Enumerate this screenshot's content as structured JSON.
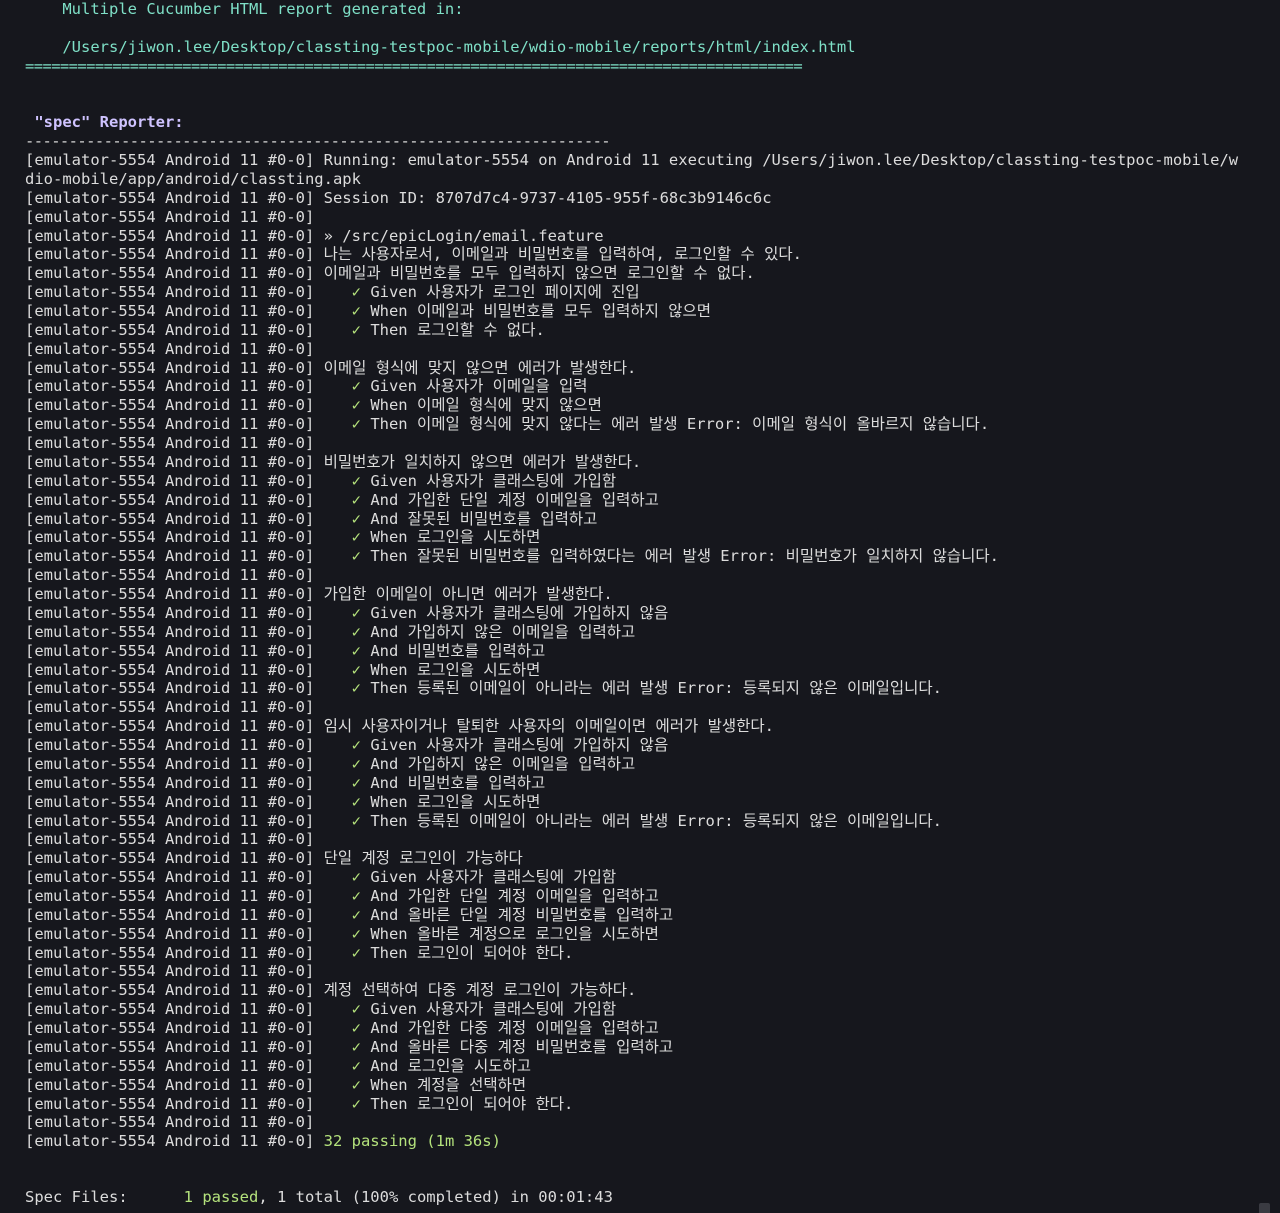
{
  "report": {
    "generated_label": "    Multiple Cucumber HTML report generated in:",
    "path": "    /Users/jiwon.lee/Desktop/classting-testpoc-mobile/wdio-mobile/reports/html/index.html",
    "separator": "========================================================================================="
  },
  "reporter": {
    "title": " \"spec\" Reporter:",
    "rule": "-------------------------------------------------------------------"
  },
  "log_lines": [
    {
      "prefix": "[emulator-5554 Android 11 #0-0] ",
      "text": "Running: emulator-5554 on Android 11 executing /Users/jiwon.lee/Desktop/classting-testpoc-mobile/w"
    },
    {
      "prefix": "",
      "text": "dio-mobile/app/android/classting.apk"
    },
    {
      "prefix": "[emulator-5554 Android 11 #0-0] ",
      "text": "Session ID: 8707d7c4-9737-4105-955f-68c3b9146c6c"
    },
    {
      "prefix": "[emulator-5554 Android 11 #0-0]",
      "text": ""
    },
    {
      "prefix": "[emulator-5554 Android 11 #0-0] ",
      "text": "» /src/epicLogin/email.feature"
    },
    {
      "prefix": "[emulator-5554 Android 11 #0-0] ",
      "text": "나는 사용자로서, 이메일과 비밀번호를 입력하여, 로그인할 수 있다."
    },
    {
      "prefix": "[emulator-5554 Android 11 #0-0] ",
      "text": "이메일과 비밀번호를 모두 입력하지 않으면 로그인할 수 없다."
    },
    {
      "prefix": "[emulator-5554 Android 11 #0-0] ",
      "check": "✓",
      "text": "Given 사용자가 로그인 페이지에 진입"
    },
    {
      "prefix": "[emulator-5554 Android 11 #0-0] ",
      "check": "✓",
      "text": "When 이메일과 비밀번호를 모두 입력하지 않으면"
    },
    {
      "prefix": "[emulator-5554 Android 11 #0-0] ",
      "check": "✓",
      "text": "Then 로그인할 수 없다."
    },
    {
      "prefix": "[emulator-5554 Android 11 #0-0]",
      "text": ""
    },
    {
      "prefix": "[emulator-5554 Android 11 #0-0] ",
      "text": "이메일 형식에 맞지 않으면 에러가 발생한다."
    },
    {
      "prefix": "[emulator-5554 Android 11 #0-0] ",
      "check": "✓",
      "text": "Given 사용자가 이메일을 입력"
    },
    {
      "prefix": "[emulator-5554 Android 11 #0-0] ",
      "check": "✓",
      "text": "When 이메일 형식에 맞지 않으면"
    },
    {
      "prefix": "[emulator-5554 Android 11 #0-0] ",
      "check": "✓",
      "text": "Then 이메일 형식에 맞지 않다는 에러 발생 Error: 이메일 형식이 올바르지 않습니다."
    },
    {
      "prefix": "[emulator-5554 Android 11 #0-0]",
      "text": ""
    },
    {
      "prefix": "[emulator-5554 Android 11 #0-0] ",
      "text": "비밀번호가 일치하지 않으면 에러가 발생한다."
    },
    {
      "prefix": "[emulator-5554 Android 11 #0-0] ",
      "check": "✓",
      "text": "Given 사용자가 클래스팅에 가입함"
    },
    {
      "prefix": "[emulator-5554 Android 11 #0-0] ",
      "check": "✓",
      "text": "And 가입한 단일 계정 이메일을 입력하고"
    },
    {
      "prefix": "[emulator-5554 Android 11 #0-0] ",
      "check": "✓",
      "text": "And 잘못된 비밀번호를 입력하고"
    },
    {
      "prefix": "[emulator-5554 Android 11 #0-0] ",
      "check": "✓",
      "text": "When 로그인을 시도하면"
    },
    {
      "prefix": "[emulator-5554 Android 11 #0-0] ",
      "check": "✓",
      "text": "Then 잘못된 비밀번호를 입력하였다는 에러 발생 Error: 비밀번호가 일치하지 않습니다."
    },
    {
      "prefix": "[emulator-5554 Android 11 #0-0]",
      "text": ""
    },
    {
      "prefix": "[emulator-5554 Android 11 #0-0] ",
      "text": "가입한 이메일이 아니면 에러가 발생한다."
    },
    {
      "prefix": "[emulator-5554 Android 11 #0-0] ",
      "check": "✓",
      "text": "Given 사용자가 클래스팅에 가입하지 않음"
    },
    {
      "prefix": "[emulator-5554 Android 11 #0-0] ",
      "check": "✓",
      "text": "And 가입하지 않은 이메일을 입력하고"
    },
    {
      "prefix": "[emulator-5554 Android 11 #0-0] ",
      "check": "✓",
      "text": "And 비밀번호를 입력하고"
    },
    {
      "prefix": "[emulator-5554 Android 11 #0-0] ",
      "check": "✓",
      "text": "When 로그인을 시도하면"
    },
    {
      "prefix": "[emulator-5554 Android 11 #0-0] ",
      "check": "✓",
      "text": "Then 등록된 이메일이 아니라는 에러 발생 Error: 등록되지 않은 이메일입니다."
    },
    {
      "prefix": "[emulator-5554 Android 11 #0-0]",
      "text": ""
    },
    {
      "prefix": "[emulator-5554 Android 11 #0-0] ",
      "text": "임시 사용자이거나 탈퇴한 사용자의 이메일이면 에러가 발생한다."
    },
    {
      "prefix": "[emulator-5554 Android 11 #0-0] ",
      "check": "✓",
      "text": "Given 사용자가 클래스팅에 가입하지 않음"
    },
    {
      "prefix": "[emulator-5554 Android 11 #0-0] ",
      "check": "✓",
      "text": "And 가입하지 않은 이메일을 입력하고"
    },
    {
      "prefix": "[emulator-5554 Android 11 #0-0] ",
      "check": "✓",
      "text": "And 비밀번호를 입력하고"
    },
    {
      "prefix": "[emulator-5554 Android 11 #0-0] ",
      "check": "✓",
      "text": "When 로그인을 시도하면"
    },
    {
      "prefix": "[emulator-5554 Android 11 #0-0] ",
      "check": "✓",
      "text": "Then 등록된 이메일이 아니라는 에러 발생 Error: 등록되지 않은 이메일입니다."
    },
    {
      "prefix": "[emulator-5554 Android 11 #0-0]",
      "text": ""
    },
    {
      "prefix": "[emulator-5554 Android 11 #0-0] ",
      "text": "단일 계정 로그인이 가능하다"
    },
    {
      "prefix": "[emulator-5554 Android 11 #0-0] ",
      "check": "✓",
      "text": "Given 사용자가 클래스팅에 가입함"
    },
    {
      "prefix": "[emulator-5554 Android 11 #0-0] ",
      "check": "✓",
      "text": "And 가입한 단일 계정 이메일을 입력하고"
    },
    {
      "prefix": "[emulator-5554 Android 11 #0-0] ",
      "check": "✓",
      "text": "And 올바른 단일 계정 비밀번호를 입력하고"
    },
    {
      "prefix": "[emulator-5554 Android 11 #0-0] ",
      "check": "✓",
      "text": "When 올바른 계정으로 로그인을 시도하면"
    },
    {
      "prefix": "[emulator-5554 Android 11 #0-0] ",
      "check": "✓",
      "text": "Then 로그인이 되어야 한다."
    },
    {
      "prefix": "[emulator-5554 Android 11 #0-0]",
      "text": ""
    },
    {
      "prefix": "[emulator-5554 Android 11 #0-0] ",
      "text": "계정 선택하여 다중 계정 로그인이 가능하다."
    },
    {
      "prefix": "[emulator-5554 Android 11 #0-0] ",
      "check": "✓",
      "text": "Given 사용자가 클래스팅에 가입함"
    },
    {
      "prefix": "[emulator-5554 Android 11 #0-0] ",
      "check": "✓",
      "text": "And 가입한 다중 계정 이메일을 입력하고"
    },
    {
      "prefix": "[emulator-5554 Android 11 #0-0] ",
      "check": "✓",
      "text": "And 올바른 다중 계정 비밀번호를 입력하고"
    },
    {
      "prefix": "[emulator-5554 Android 11 #0-0] ",
      "check": "✓",
      "text": "And 로그인을 시도하고"
    },
    {
      "prefix": "[emulator-5554 Android 11 #0-0] ",
      "check": "✓",
      "text": "When 계정을 선택하면"
    },
    {
      "prefix": "[emulator-5554 Android 11 #0-0] ",
      "check": "✓",
      "text": "Then 로그인이 되어야 한다."
    },
    {
      "prefix": "[emulator-5554 Android 11 #0-0]",
      "text": ""
    },
    {
      "prefix": "[emulator-5554 Android 11 #0-0] ",
      "text": "32 passing (1m 36s)",
      "passing": true
    }
  ],
  "summary": {
    "label": "Spec Files:",
    "passed": "1 passed",
    "rest": ", 1 total (100% completed) in 00:01:43"
  },
  "colors": {
    "background": "#16171d",
    "text": "#dcdcdc",
    "teal": "#7fe0c7",
    "lavender": "#cfc3ff",
    "green": "#b4e27c"
  }
}
